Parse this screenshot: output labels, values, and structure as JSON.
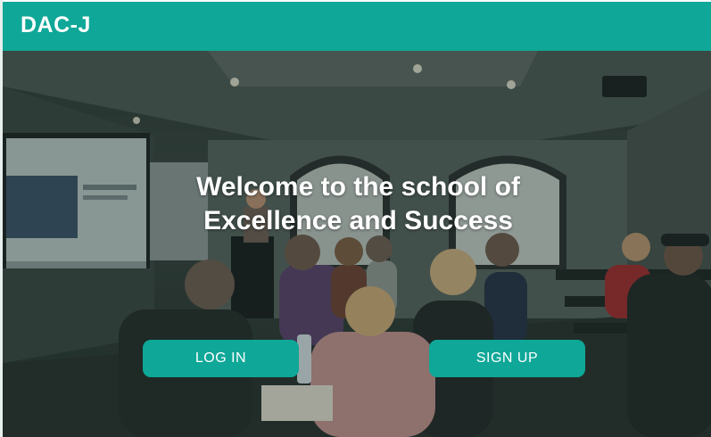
{
  "header": {
    "brand": "DAC-J"
  },
  "hero": {
    "headline_line1": "Welcome to the school of",
    "headline_line2": "Excellence and Success"
  },
  "actions": {
    "login_label": "LOG IN",
    "signup_label": "SIGN UP"
  },
  "colors": {
    "accent": "#0fa797",
    "text_on_accent": "#ffffff"
  }
}
